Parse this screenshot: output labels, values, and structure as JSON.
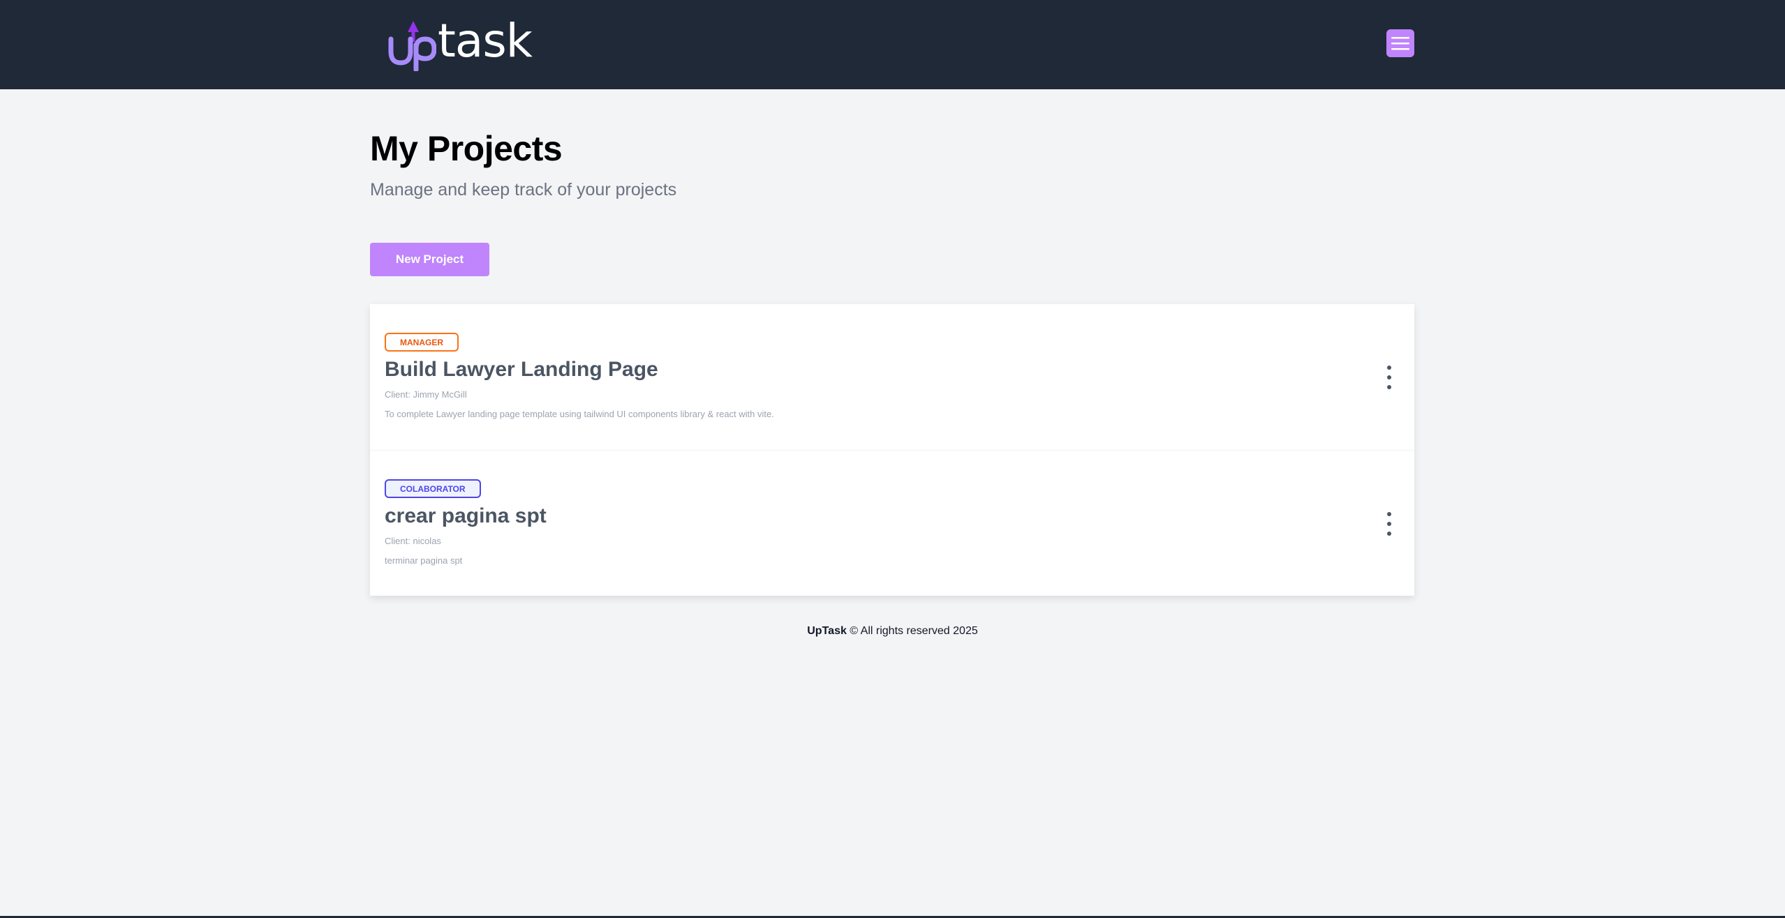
{
  "header": {
    "logo_text": "task",
    "brand_color": "#c084fc",
    "menu_button_icon": "hamburger-menu-icon"
  },
  "main": {
    "title": "My Projects",
    "subtitle": "Manage and keep track of your projects",
    "new_project_label": "New Project"
  },
  "projects": [
    {
      "role": "MANAGER",
      "name": "Build Lawyer Landing Page",
      "client": "Client: Jimmy McGill",
      "description": "To complete Lawyer landing page template using tailwind UI components library & react with vite."
    },
    {
      "role": "COLABORATOR",
      "name": "crear pagina spt",
      "client": "Client: nicolas",
      "description": "terminar pagina spt"
    }
  ],
  "footer": {
    "brand": "UpTask",
    "text": " © All rights reserved 2025"
  },
  "colors": {
    "header_bg": "#1f2937",
    "page_bg": "#f3f4f6",
    "manager_badge": "#f97316",
    "collaborator_badge": "#4f46e5"
  }
}
